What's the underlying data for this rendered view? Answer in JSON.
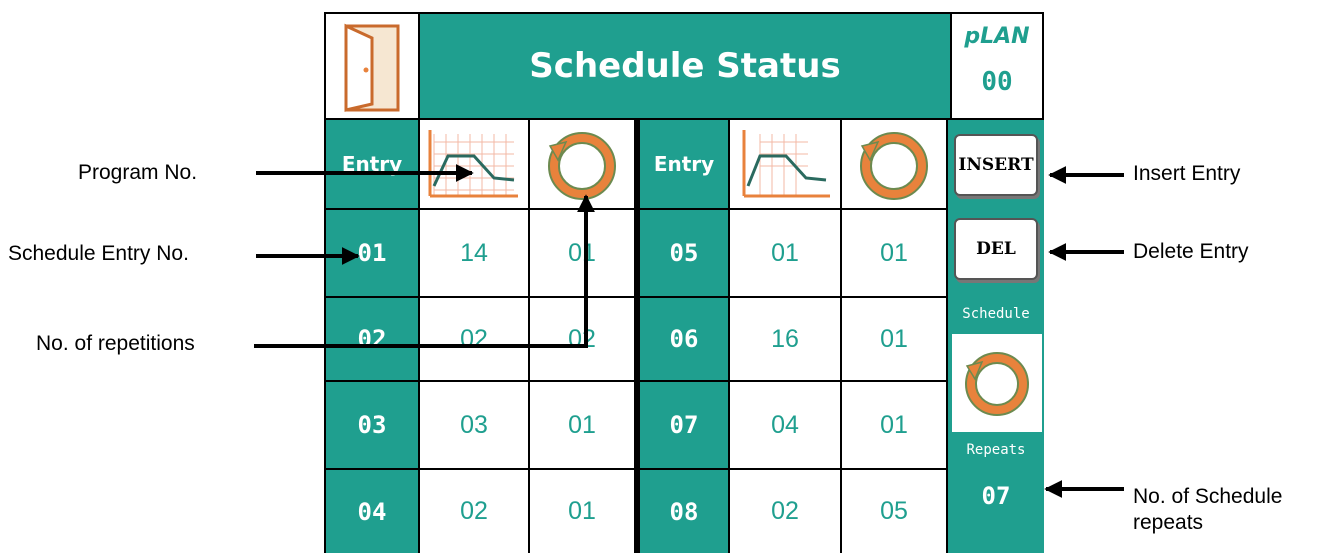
{
  "header": {
    "title": "Schedule Status",
    "plan_label": "pLAN",
    "plan_value": "00",
    "icon": "door-icon"
  },
  "table": {
    "entry_header": "Entry",
    "program_icon": "program-chart-icon",
    "repeat_icon": "repeat-cycle-icon",
    "left_rows": [
      {
        "entry": "01",
        "program": "14",
        "repeats": "01"
      },
      {
        "entry": "02",
        "program": "02",
        "repeats": "02"
      },
      {
        "entry": "03",
        "program": "03",
        "repeats": "01"
      },
      {
        "entry": "04",
        "program": "02",
        "repeats": "01"
      }
    ],
    "right_rows": [
      {
        "entry": "05",
        "program": "01",
        "repeats": "01"
      },
      {
        "entry": "06",
        "program": "16",
        "repeats": "01"
      },
      {
        "entry": "07",
        "program": "04",
        "repeats": "01"
      },
      {
        "entry": "08",
        "program": "02",
        "repeats": "05"
      }
    ]
  },
  "side_panel": {
    "insert_label": "INSERT",
    "delete_label": "DEL",
    "schedule_label": "Schedule",
    "repeats_label": "Repeats",
    "repeats_value": "07"
  },
  "callouts": {
    "program_no": "Program No.",
    "schedule_entry_no": "Schedule Entry No.",
    "repetitions": "No. of repetitions",
    "insert_entry": "Insert Entry",
    "delete_entry": "Delete Entry",
    "schedule_repeats_line1": "No. of Schedule",
    "schedule_repeats_line2": "repeats"
  },
  "colors": {
    "teal": "#1f9f8f",
    "orange": "#e8823c",
    "door_frame": "#c96a2c"
  }
}
